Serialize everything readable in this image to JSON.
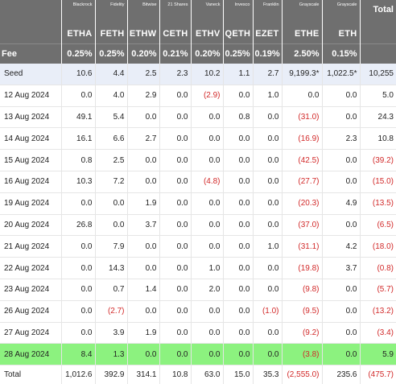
{
  "header": {
    "issuers": [
      "",
      "Blackrock",
      "Fidelity",
      "Bitwise",
      "21 Shares",
      "Vaneck",
      "Invesco",
      "Franklin",
      "Grayscale",
      "Grayscale",
      "Total"
    ],
    "tickers": [
      "",
      "ETHA",
      "FETH",
      "ETHW",
      "CETH",
      "ETHV",
      "QETH",
      "EZET",
      "ETHE",
      "ETH",
      ""
    ],
    "fee_label": "Fee",
    "fees": [
      "0.25%",
      "0.25%",
      "0.20%",
      "0.21%",
      "0.20%",
      "0.25%",
      "0.19%",
      "2.50%",
      "0.15%",
      ""
    ]
  },
  "rows": [
    {
      "label": "Seed",
      "values": [
        "10.6",
        "4.4",
        "2.5",
        "2.3",
        "10.2",
        "1.1",
        "2.7",
        "9,199.3*",
        "1,022.5*",
        "10,255"
      ]
    },
    {
      "label": "12 Aug 2024",
      "values": [
        "0.0",
        "4.0",
        "2.9",
        "0.0",
        "(2.9)",
        "0.0",
        "1.0",
        "0.0",
        "0.0",
        "5.0"
      ]
    },
    {
      "label": "13 Aug 2024",
      "values": [
        "49.1",
        "5.4",
        "0.0",
        "0.0",
        "0.0",
        "0.8",
        "0.0",
        "(31.0)",
        "0.0",
        "24.3"
      ]
    },
    {
      "label": "14 Aug 2024",
      "values": [
        "16.1",
        "6.6",
        "2.7",
        "0.0",
        "0.0",
        "0.0",
        "0.0",
        "(16.9)",
        "2.3",
        "10.8"
      ]
    },
    {
      "label": "15 Aug 2024",
      "values": [
        "0.8",
        "2.5",
        "0.0",
        "0.0",
        "0.0",
        "0.0",
        "0.0",
        "(42.5)",
        "0.0",
        "(39.2)"
      ]
    },
    {
      "label": "16 Aug 2024",
      "values": [
        "10.3",
        "7.2",
        "0.0",
        "0.0",
        "(4.8)",
        "0.0",
        "0.0",
        "(27.7)",
        "0.0",
        "(15.0)"
      ]
    },
    {
      "label": "19 Aug 2024",
      "values": [
        "0.0",
        "0.0",
        "1.9",
        "0.0",
        "0.0",
        "0.0",
        "0.0",
        "(20.3)",
        "4.9",
        "(13.5)"
      ]
    },
    {
      "label": "20 Aug 2024",
      "values": [
        "26.8",
        "0.0",
        "3.7",
        "0.0",
        "0.0",
        "0.0",
        "0.0",
        "(37.0)",
        "0.0",
        "(6.5)"
      ]
    },
    {
      "label": "21 Aug 2024",
      "values": [
        "0.0",
        "7.9",
        "0.0",
        "0.0",
        "0.0",
        "0.0",
        "1.0",
        "(31.1)",
        "4.2",
        "(18.0)"
      ]
    },
    {
      "label": "22 Aug 2024",
      "values": [
        "0.0",
        "14.3",
        "0.0",
        "0.0",
        "1.0",
        "0.0",
        "0.0",
        "(19.8)",
        "3.7",
        "(0.8)"
      ]
    },
    {
      "label": "23 Aug 2024",
      "values": [
        "0.0",
        "0.7",
        "1.4",
        "0.0",
        "2.0",
        "0.0",
        "0.0",
        "(9.8)",
        "0.0",
        "(5.7)"
      ]
    },
    {
      "label": "26 Aug 2024",
      "values": [
        "0.0",
        "(2.7)",
        "0.0",
        "0.0",
        "0.0",
        "0.0",
        "(1.0)",
        "(9.5)",
        "0.0",
        "(13.2)"
      ]
    },
    {
      "label": "27 Aug 2024",
      "values": [
        "0.0",
        "3.9",
        "1.9",
        "0.0",
        "0.0",
        "0.0",
        "0.0",
        "(9.2)",
        "0.0",
        "(3.4)"
      ]
    },
    {
      "label": "28 Aug 2024",
      "values": [
        "8.4",
        "1.3",
        "0.0",
        "0.0",
        "0.0",
        "0.0",
        "0.0",
        "(3.8)",
        "0.0",
        "5.9"
      ]
    },
    {
      "label": "Total",
      "values": [
        "1,012.6",
        "392.9",
        "314.1",
        "10.8",
        "63.0",
        "15.0",
        "35.3",
        "(2,555.0)",
        "235.6",
        "(475.7)"
      ]
    }
  ],
  "colors": {
    "header_bg": "#6f6f6f",
    "seed_bg": "#e9eef8",
    "highlight_bg": "#8cf27f",
    "negative": "#d22a2a"
  }
}
